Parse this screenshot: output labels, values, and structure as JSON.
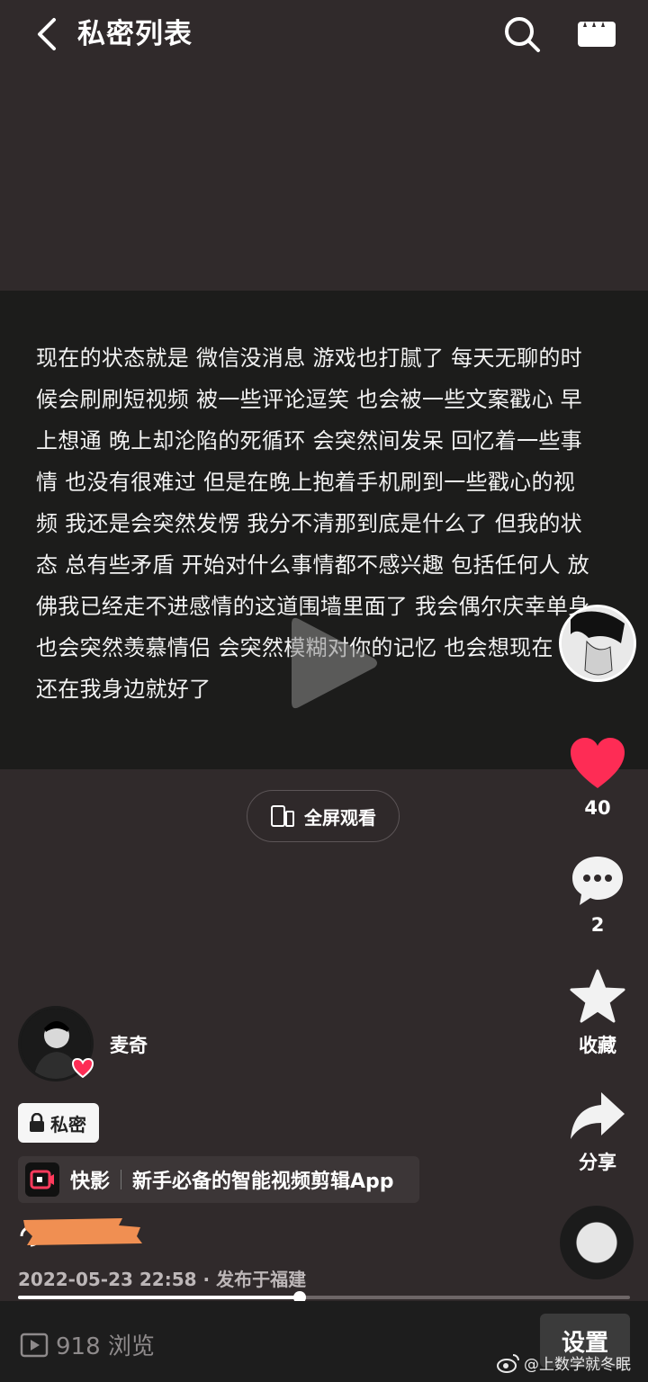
{
  "header": {
    "title": "私密列表"
  },
  "video": {
    "caption_lines": [
      "现在的状态就是 微信没消息 游戏也打腻了 每天无聊的时",
      "候会刷刷短视频 被一些评论逗笑 也会被一些文案戳心 早",
      "上想通 晚上却沦陷的死循环 会突然间发呆 回忆着一些事",
      "情 也没有很难过 但是在晚上抱着手机刷到一些戳心的视",
      "频 我还是会突然发愣 我分不清那到底是什么了 但我的状",
      "态 总有些矛盾 开始对什么事情都不感兴趣 包括任何人 放",
      "佛我已经走不进感情的这道围墙里面了 我会偶尔庆幸单身",
      "也会突然羡慕情侣 会突然模糊对你的记忆 也会想现在",
      "还在我身边就好了"
    ],
    "fullscreen_label": "全屏观看",
    "progress_fraction": 0.46
  },
  "rail": {
    "like_count": "40",
    "comment_count": "2",
    "favorite_label": "收藏",
    "share_label": "分享",
    "like_color": "#fe2c55"
  },
  "author": {
    "name": "麦奇"
  },
  "private_badge": "私密",
  "app_banner": {
    "name": "快影",
    "slogan": "新手必备的智能视频剪辑App"
  },
  "publish_info": "2022-05-23 22:58 · 发布于福建",
  "bottom": {
    "views": "918 浏览",
    "settings_label": "设置"
  },
  "watermark": "@上数学就冬眠"
}
